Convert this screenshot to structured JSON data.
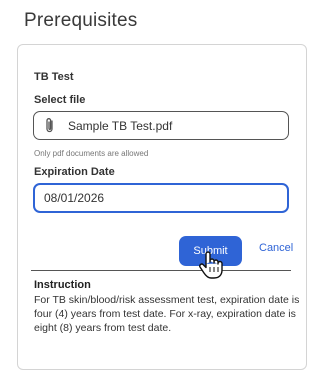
{
  "page": {
    "title": "Prerequisites"
  },
  "form": {
    "section_title": "TB Test",
    "select_file_label": "Select file",
    "file_name": "Sample TB Test.pdf",
    "file_hint": "Only pdf documents are allowed",
    "expiration_label": "Expiration Date",
    "expiration_value": "08/01/2026",
    "submit_label": "Submit",
    "cancel_label": "Cancel"
  },
  "instruction": {
    "title": "Instruction",
    "text": "For TB skin/blood/risk assessment test, expiration date is four (4) years from test date. For x-ray, expiration date is eight (8) years from test date."
  },
  "colors": {
    "accent": "#2f64d6",
    "border": "#d4d4d4"
  },
  "icons": {
    "attachment": "paperclip-icon",
    "cursor": "hand-pointer-icon"
  }
}
